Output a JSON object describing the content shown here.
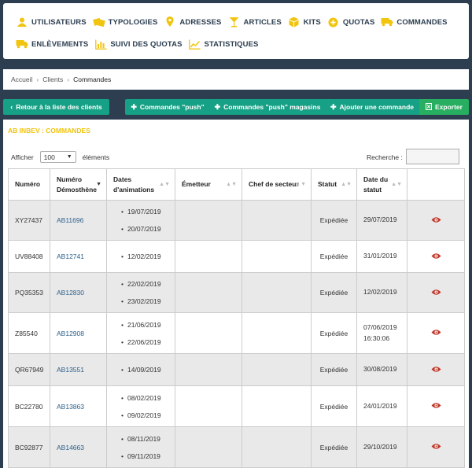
{
  "nav": {
    "row1": [
      {
        "label": "UTILISATEURS",
        "icon": "users-icon"
      },
      {
        "label": "TYPOLOGIES",
        "icon": "typologies-icon"
      },
      {
        "label": "ADRESSES",
        "icon": "map-pin-icon"
      },
      {
        "label": "ARTICLES",
        "icon": "cocktail-icon"
      },
      {
        "label": "KITS",
        "icon": "cube-icon"
      },
      {
        "label": "QUOTAS",
        "icon": "plus-circle-icon"
      },
      {
        "label": "COMMANDES",
        "icon": "truck-icon"
      }
    ],
    "row2": [
      {
        "label": "ENLÈVEMENTS",
        "icon": "truck-icon"
      },
      {
        "label": "SUIVI DES QUOTAS",
        "icon": "bar-chart-icon"
      },
      {
        "label": "STATISTIQUES",
        "icon": "line-chart-icon"
      }
    ],
    "icon_color": "#f1c40f"
  },
  "breadcrumb": {
    "items": [
      "Accueil",
      "Clients",
      "Commandes"
    ]
  },
  "actions": {
    "back": "Retour à la liste des clients",
    "push": "Commandes \"push\"",
    "push_magasins": "Commandes \"push\" magasins",
    "add": "Ajouter une commande",
    "export": "Exporter"
  },
  "panel": {
    "title": "AB INBEV : COMMANDES",
    "afficher_label": "Afficher",
    "page_size": "100",
    "elements_label": "éléments",
    "search_label": "Recherche :"
  },
  "table": {
    "headers": {
      "numero": "Numéro",
      "demosthene": "Numéro Démosthène",
      "dates": "Dates d'animations",
      "emetteur": "Émetteur",
      "chef": "Chef de secteur",
      "statut": "Statut",
      "date_statut": "Date du statut"
    },
    "rows": [
      {
        "numero": "XY27437",
        "demosthene": "AB11696",
        "dates": [
          "19/07/2019",
          "20/07/2019"
        ],
        "statut": "Expédiée",
        "date_statut": "29/07/2019",
        "date_statut_time": ""
      },
      {
        "numero": "UV88408",
        "demosthene": "AB12741",
        "dates": [
          "12/02/2019"
        ],
        "statut": "Expédiée",
        "date_statut": "31/01/2019",
        "date_statut_time": ""
      },
      {
        "numero": "PQ35353",
        "demosthene": "AB12830",
        "dates": [
          "22/02/2019",
          "23/02/2019"
        ],
        "statut": "Expédiée",
        "date_statut": "12/02/2019",
        "date_statut_time": ""
      },
      {
        "numero": "Z85540",
        "demosthene": "AB12908",
        "dates": [
          "21/06/2019",
          "22/06/2019"
        ],
        "statut": "Expédiée",
        "date_statut": "07/06/2019",
        "date_statut_time": "16:30:06"
      },
      {
        "numero": "QR67949",
        "demosthene": "AB13551",
        "dates": [
          "14/09/2019"
        ],
        "statut": "Expédiée",
        "date_statut": "30/08/2019",
        "date_statut_time": ""
      },
      {
        "numero": "BC22780",
        "demosthene": "AB13863",
        "dates": [
          "08/02/2019",
          "09/02/2019"
        ],
        "statut": "Expédiée",
        "date_statut": "24/01/2019",
        "date_statut_time": ""
      },
      {
        "numero": "BC92877",
        "demosthene": "AB14663",
        "dates": [
          "08/11/2019",
          "09/11/2019"
        ],
        "statut": "Expédiée",
        "date_statut": "29/10/2019",
        "date_statut_time": ""
      }
    ]
  }
}
